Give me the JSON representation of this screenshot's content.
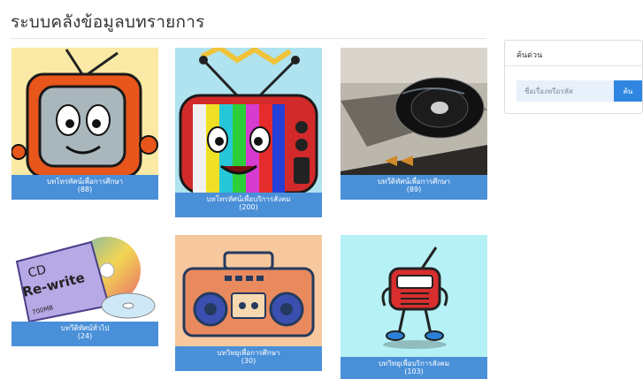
{
  "page": {
    "title": "ระบบคลังข้อมูลบทรายการ"
  },
  "search": {
    "heading": "ค้นด่วน",
    "placeholder": "ชื่อเรื่องหรือรหัส",
    "button_label": "ค้น"
  },
  "tiles": [
    {
      "name": "บทโทรทัศน์เพื่อการศึกษา",
      "count": "(88)",
      "icon": "cartoon-tv-icon"
    },
    {
      "name": "บทโทรทัศน์เพื่อบริการสังคม",
      "count": "(200)",
      "icon": "color-bars-tv-icon"
    },
    {
      "name": "บทวีดิทัศน์เพื่อการศึกษา",
      "count": "(89)",
      "icon": "dvd-player-icon"
    },
    {
      "name": "บทวีดิทัศน์ทั่วไป",
      "count": "(24)",
      "icon": "cd-disc-icon",
      "disc_text_1": "CD",
      "disc_text_2": "Re-write",
      "disc_text_3": "700MB"
    },
    {
      "name": "บทวิทยุเพื่อการศึกษา",
      "count": "(30)",
      "icon": "boombox-radio-icon"
    },
    {
      "name": "บทวิทยุเพื่อบริการสังคม",
      "count": "(103)",
      "icon": "cartoon-radio-icon"
    }
  ]
}
